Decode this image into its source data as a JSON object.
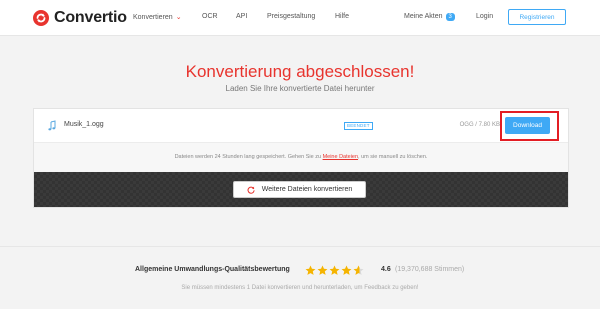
{
  "header": {
    "logo_text": "Convertio",
    "nav": {
      "convert": "Konvertieren",
      "ocr": "OCR",
      "api": "API",
      "pricing": "Preisgestaltung",
      "help": "Hilfe"
    },
    "my_files": "Meine Akten",
    "my_files_count": "3",
    "login": "Login",
    "register": "Registrieren"
  },
  "hero": {
    "title": "Konvertierung abgeschlossen!",
    "subtitle": "Laden Sie Ihre konvertierte Datei herunter"
  },
  "file": {
    "name": "Musik_1.ogg",
    "status": "BEENDET",
    "size": "OGG / 7.80 KB",
    "download_label": "Download"
  },
  "info": {
    "text_before": "Dateien werden 24 Stunden lang gespeichert. Gehen Sie zu ",
    "link": "Meine Dateien",
    "text_after": ", um sie manuell zu löschen."
  },
  "convert_more_label": "Weitere Dateien konvertieren",
  "rating": {
    "label": "Allgemeine Umwandlungs-Qualitätsbewertung",
    "value": "4.6",
    "count": "(19,370,688 Stimmen)",
    "stars_filled": 4.6,
    "note": "Sie müssen mindestens 1 Datei konvertieren und herunterladen, um Feedback zu geben!"
  },
  "colors": {
    "brand_red": "#e8342e",
    "accent_blue": "#3fa9f5",
    "star": "#f5b400",
    "highlight": "#e31e24"
  },
  "icons": {
    "logo": "convertio-logo-icon",
    "file": "music-note-icon",
    "refresh": "refresh-icon",
    "star": "star-icon"
  }
}
